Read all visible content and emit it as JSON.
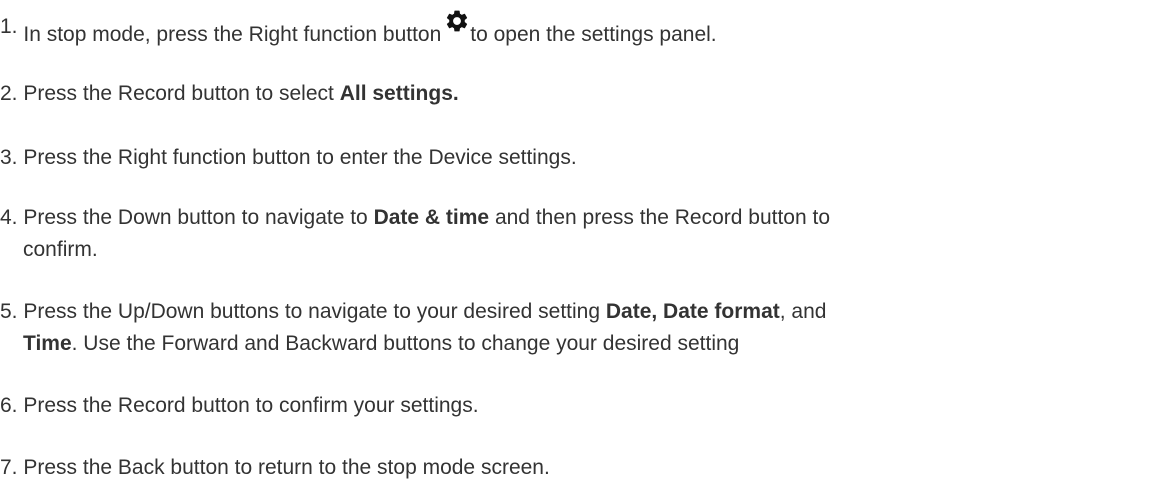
{
  "steps": [
    {
      "num": "1.",
      "text_before": "In stop mode, press the Right function button",
      "icon": "gear-icon",
      "text_after": "to open the settings panel."
    },
    {
      "num": "2.",
      "text_before": "Press the Record button to select ",
      "bold": "All settings."
    },
    {
      "num": "3.",
      "text": "Press the Right function button to enter the Device settings."
    },
    {
      "num": "4.",
      "text_before": "Press the Down button to navigate to ",
      "bold": "Date & time",
      "text_after": " and then press the Record button to",
      "continuation": "confirm."
    },
    {
      "num": "5.",
      "text_before": "Press the Up/Down buttons to navigate to your desired setting ",
      "bold1": "Date, Date format",
      "text_mid": ", and",
      "bold2": "Time",
      "continuation_after": ". Use the Forward and Backward buttons to change your desired setting"
    },
    {
      "num": "6.",
      "text": "Press the Record button to confirm your settings."
    },
    {
      "num": "7.",
      "text": "Press the Back button to return to the stop mode screen."
    }
  ],
  "colors": {
    "text": "#333333",
    "background": "#ffffff"
  }
}
